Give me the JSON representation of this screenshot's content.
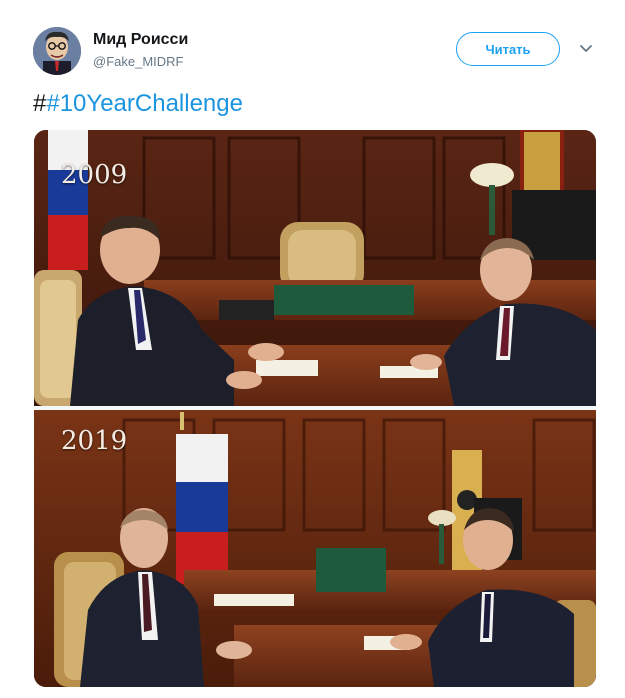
{
  "tweet": {
    "author": {
      "display_name": "Мид Роисси",
      "handle": "@Fake_MIDRF"
    },
    "follow_button_label": "Читать",
    "text_prefix": "#",
    "hashtag": "#10YearChallenge",
    "media": {
      "panels": [
        {
          "year_label": "2009"
        },
        {
          "year_label": "2019"
        }
      ]
    }
  },
  "colors": {
    "accent": "#1da1f2",
    "hashtag": "#1b95e0",
    "text": "#14171a",
    "secondary": "#657786"
  }
}
